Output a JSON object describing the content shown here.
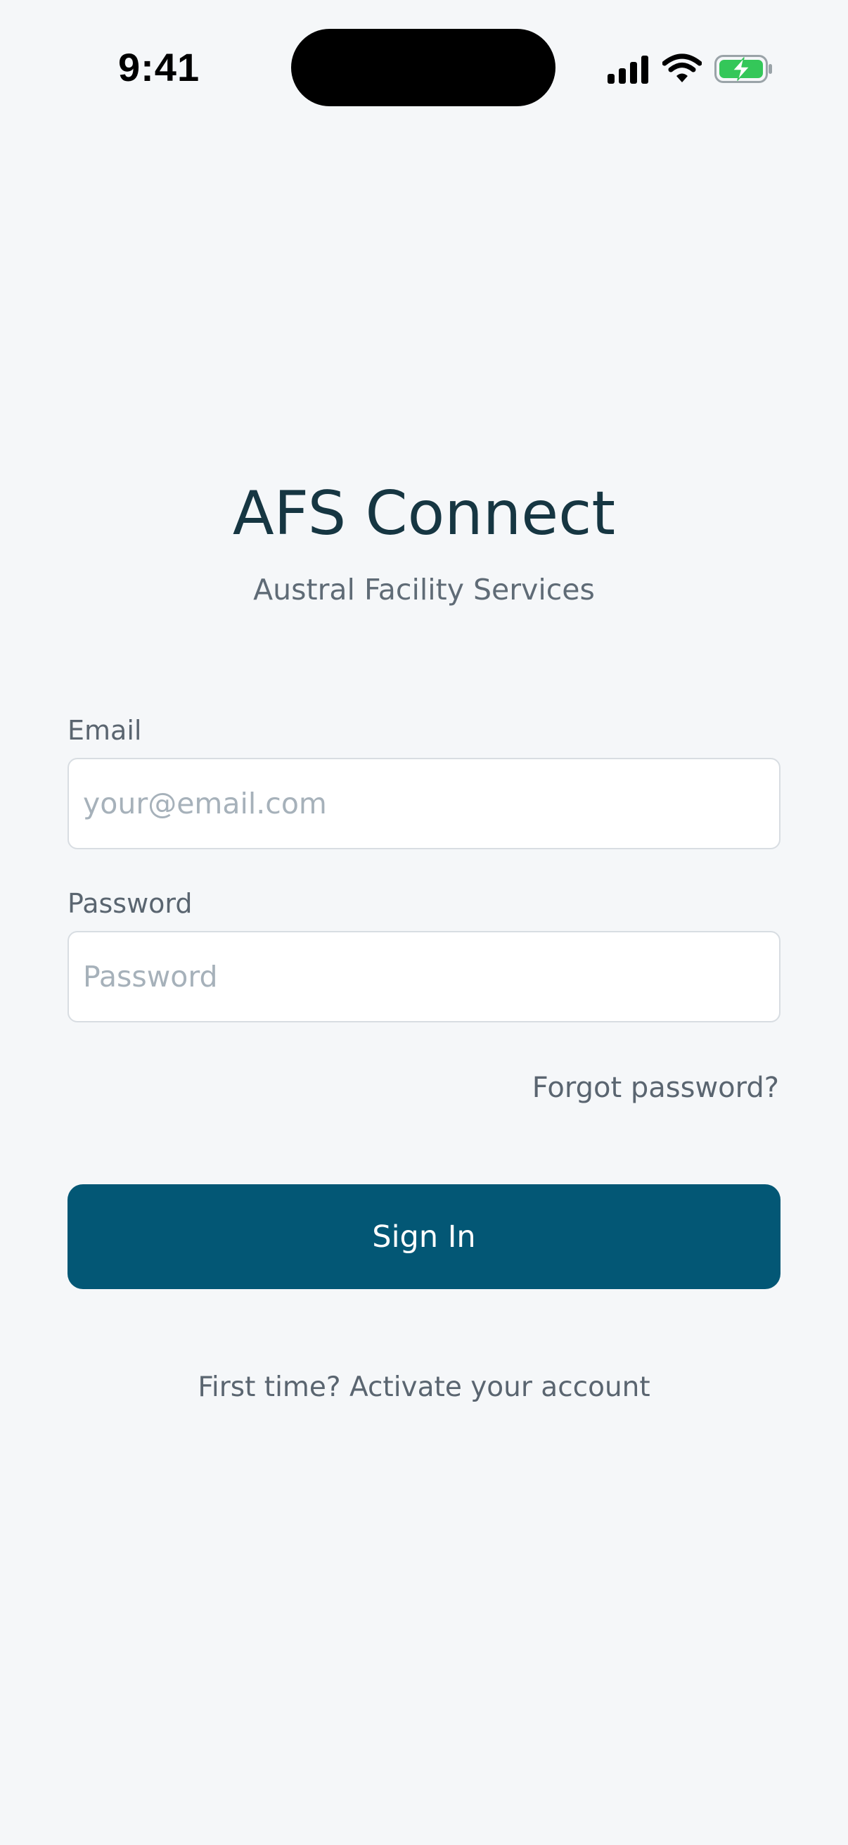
{
  "status_bar": {
    "time": "9:41",
    "icons": [
      "signal-icon",
      "wifi-icon",
      "battery-charging-icon"
    ],
    "battery_color": "#34c759"
  },
  "header": {
    "title": "AFS Connect",
    "subtitle": "Austral Facility Services"
  },
  "form": {
    "email": {
      "label": "Email",
      "value": "",
      "placeholder": "your@email.com"
    },
    "password": {
      "label": "Password",
      "value": "",
      "placeholder": "Password"
    },
    "forgot_password_label": "Forgot password?",
    "sign_in_label": "Sign In",
    "activate_label": "First time? Activate your account"
  },
  "colors": {
    "background": "#f5f7f9",
    "primary": "#035775",
    "title_text": "#163642",
    "secondary_text": "#5a6570",
    "placeholder_text": "#a6b1ba",
    "input_border": "#d8dde2"
  }
}
